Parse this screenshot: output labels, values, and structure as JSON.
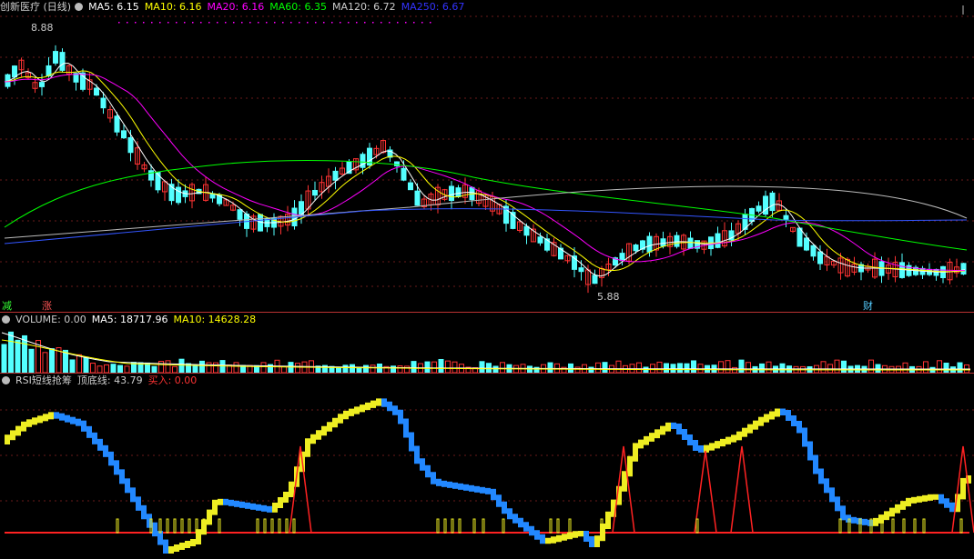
{
  "price_panel": {
    "title": "创新医疗 (日线)",
    "ma_labels": [
      {
        "text": "MA5: 6.15",
        "color": "#ffffff"
      },
      {
        "text": "MA10: 6.16",
        "color": "#ffff00"
      },
      {
        "text": "MA20: 6.16",
        "color": "#ff00ff"
      },
      {
        "text": "MA60: 6.35",
        "color": "#00ff00"
      },
      {
        "text": "MA120: 6.72",
        "color": "#cccccc"
      },
      {
        "text": "MA250: 6.67",
        "color": "#3333ff"
      }
    ],
    "high_label": "8.88",
    "low_label": "5.88",
    "tags": {
      "left1": "减",
      "left2": "涨",
      "right": "财"
    }
  },
  "volume_panel": {
    "title": "VOLUME: 0.00",
    "ma5": "MA5: 18717.96",
    "ma10": "MA10: 14628.28"
  },
  "rsi_panel": {
    "title": "RSI短线抢筹",
    "line_label": "顶底线: 43.79",
    "buy_label": "买入: 0.00"
  },
  "colors": {
    "up": "#ff3333",
    "down": "#54ffff",
    "bg": "#000000"
  }
}
